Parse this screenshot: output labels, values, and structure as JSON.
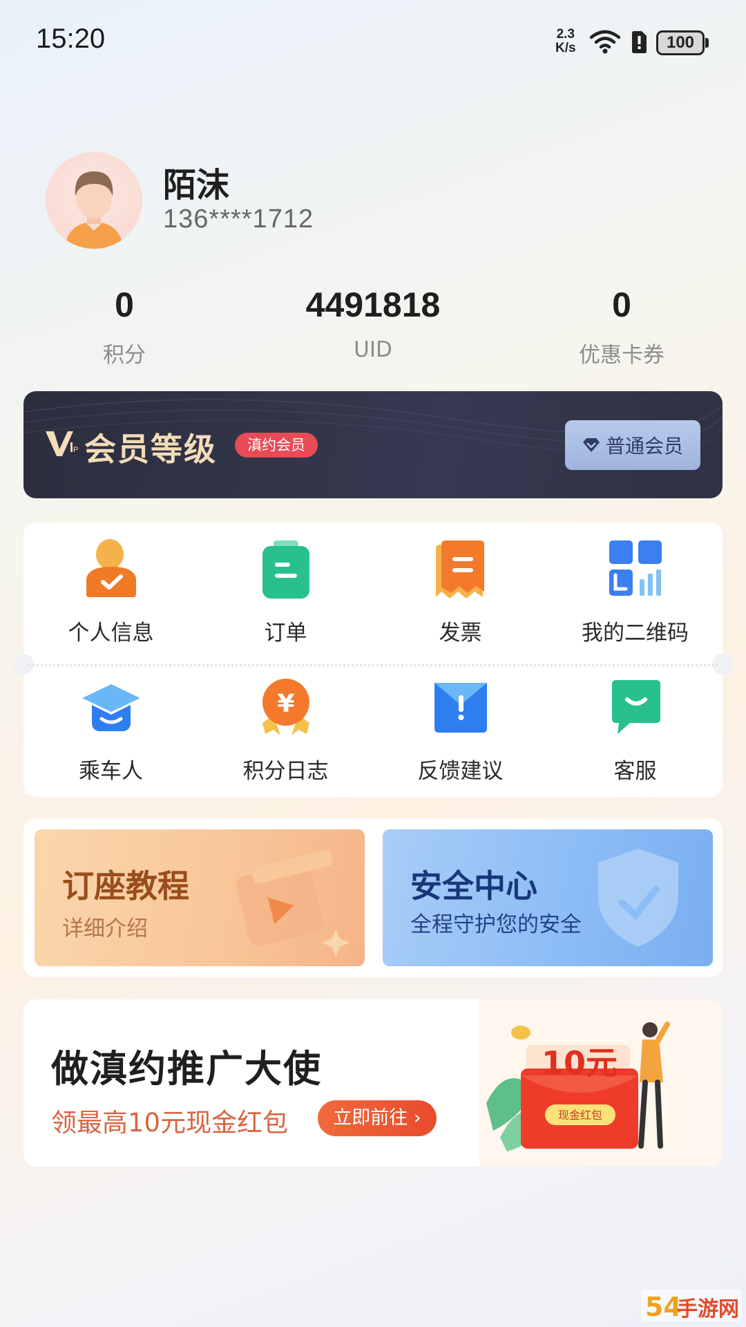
{
  "status_bar": {
    "time": "15:20",
    "net_speed_top": "2.3",
    "net_speed_bottom": "K/s",
    "battery": "100"
  },
  "profile": {
    "name": "陌沫",
    "phone": "136****1712"
  },
  "stats": [
    {
      "value": "0",
      "label": "积分"
    },
    {
      "value": "4491818",
      "label": "UID"
    },
    {
      "value": "0",
      "label": "优惠卡券"
    }
  ],
  "vip": {
    "title": "会员等级",
    "tag": "滇约会员",
    "level_button": "普通会员"
  },
  "grid": {
    "row1": [
      {
        "label": "个人信息",
        "icon": "personal-info-icon"
      },
      {
        "label": "订单",
        "icon": "order-icon"
      },
      {
        "label": "发票",
        "icon": "invoice-icon"
      },
      {
        "label": "我的二维码",
        "icon": "qr-code-icon"
      }
    ],
    "row2": [
      {
        "label": "乘车人",
        "icon": "passenger-icon"
      },
      {
        "label": "积分日志",
        "icon": "points-log-icon"
      },
      {
        "label": "反馈建议",
        "icon": "feedback-icon"
      },
      {
        "label": "客服",
        "icon": "customer-service-icon"
      }
    ]
  },
  "promos": {
    "tutorial": {
      "title": "订座教程",
      "subtitle": "详细介绍"
    },
    "security": {
      "title": "安全中心",
      "subtitle": "全程守护您的安全"
    }
  },
  "invite": {
    "title": "做滇约推广大使",
    "subtitle": "领最高10元现金红包",
    "button": "立即前往",
    "envelope_amount": "10元",
    "envelope_label": "现金红包"
  },
  "colors": {
    "vip_gold": "#f3dcb8",
    "vip_tag_red": "#e84b55",
    "accent_orange": "#e84b2c",
    "icon_orange": "#f08a2c",
    "icon_green": "#27c08e",
    "icon_blue": "#3b7ff0"
  }
}
